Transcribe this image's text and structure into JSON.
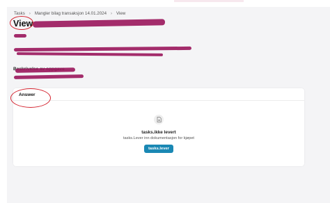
{
  "breadcrumb": {
    "items": [
      "Tasks",
      "Mangler bilag transaksjon 14.01.2024",
      "View"
    ]
  },
  "page": {
    "title": "View"
  },
  "section": {
    "label": "Beskrivelse av oppgave"
  },
  "answer_card": {
    "title": "Answer",
    "empty_title": "tasks.ikke levert",
    "empty_subtitle": "tasks.Lever inn dokumentasjon for kjøpet",
    "button_label": "tasks.lever",
    "icon": "document-icon"
  },
  "colors": {
    "accent": "#1a88b4",
    "annotation": "#d4232f",
    "redaction": "#9b1a5e"
  }
}
